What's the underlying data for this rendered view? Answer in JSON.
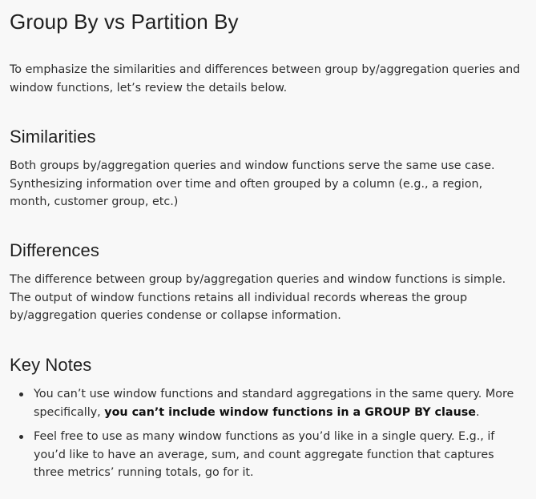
{
  "page": {
    "title": "Group By vs Partition By",
    "intro": "To emphasize the similarities and differences between group by/aggregation queries and window functions, let’s review the details below."
  },
  "sections": {
    "similarities": {
      "heading": "Similarities",
      "body": "Both groups by/aggregation queries and window functions serve the same use case. Synthesizing information over time and often grouped by a column (e.g., a region, month, customer group, etc.)"
    },
    "differences": {
      "heading": "Differences",
      "body": "The difference between group by/aggregation queries and window functions is simple. The output of window functions retains all individual records whereas the group by/aggregation queries condense or collapse information."
    },
    "key_notes": {
      "heading": "Key Notes",
      "items": [
        {
          "text": "You can’t use window functions and standard aggregations in the same query. More specifically, ",
          "strong": "you can’t include window functions in a GROUP BY clause",
          "after": "."
        },
        {
          "text": "Feel free to use as many window functions as you’d like in a single query. E.g., if you’d like to have an average, sum, and count aggregate function that captures three metrics’ running totals, go for it."
        }
      ]
    }
  }
}
